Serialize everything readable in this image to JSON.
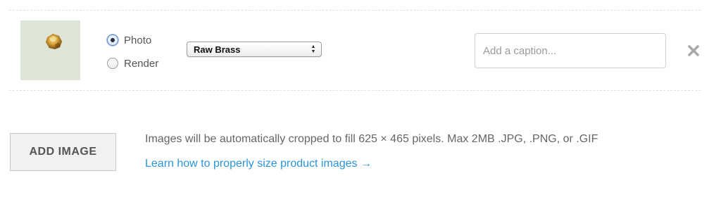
{
  "image_row": {
    "thumbnail_alt": "gold nugget product photo",
    "type_options": [
      {
        "label": "Photo",
        "selected": true
      },
      {
        "label": "Render",
        "selected": false
      }
    ],
    "material_select": {
      "value": "Raw Brass"
    },
    "caption": {
      "value": "",
      "placeholder": "Add a caption..."
    },
    "remove_icon": "close-x-icon"
  },
  "add_image": {
    "button_label": "ADD IMAGE",
    "info_text": "Images will be automatically cropped to fill 625 × 465 pixels. Max 2MB .JPG, .PNG, or .GIF",
    "help_link": "Learn how to properly size product images →"
  },
  "colors": {
    "link": "#2a95d8",
    "button_bg": "#f1f1f1",
    "thumbnail_bg": "#dde5d6"
  }
}
